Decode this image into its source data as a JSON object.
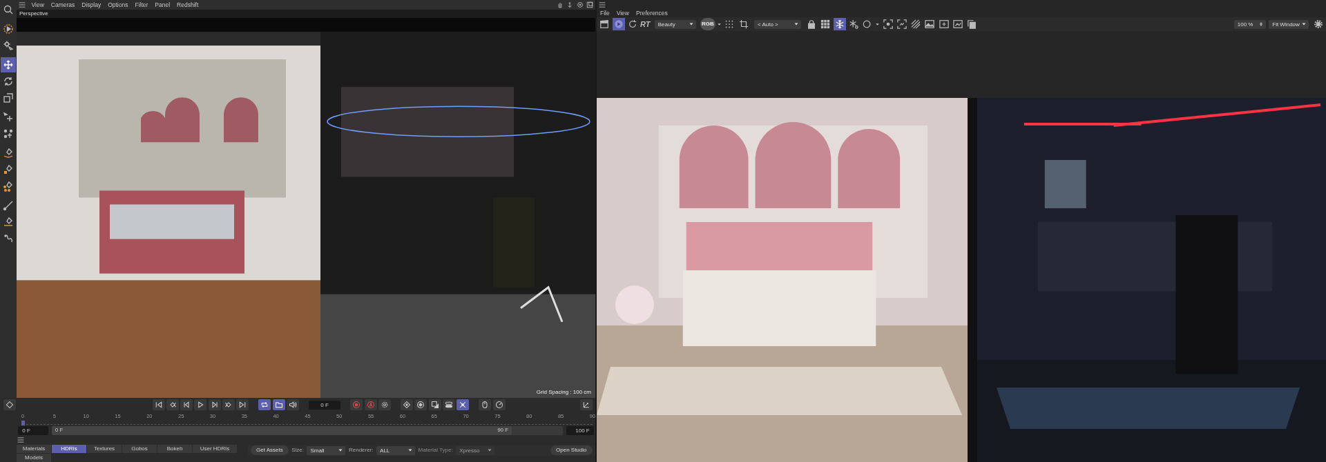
{
  "viewport": {
    "menu": [
      "View",
      "Cameras",
      "Display",
      "Options",
      "Filter",
      "Panel",
      "Redshift"
    ],
    "label": "Perspective",
    "grid_spacing": "Grid Spacing : 100 cm"
  },
  "tools": [
    {
      "selected": false
    },
    {
      "selected": false
    },
    {
      "selected": false
    },
    {
      "selected": true
    },
    {
      "selected": false
    },
    {
      "selected": false
    },
    {
      "selected": false
    },
    {
      "selected": false
    },
    {
      "selected": false
    },
    {
      "selected": false
    },
    {
      "selected": false
    },
    {
      "selected": false
    },
    {
      "selected": false
    },
    {
      "selected": false
    }
  ],
  "timeline": {
    "controls": [
      {
        "kind": "button",
        "selected": false
      },
      {
        "kind": "button",
        "selected": false
      },
      {
        "kind": "button",
        "selected": false
      },
      {
        "kind": "button",
        "selected": false
      },
      {
        "kind": "button",
        "selected": false
      },
      {
        "kind": "button",
        "selected": false
      },
      {
        "kind": "button",
        "selected": false
      },
      {
        "kind": "button",
        "selected": true
      },
      {
        "kind": "button",
        "selected": true
      },
      {
        "kind": "button",
        "selected": false
      },
      {
        "kind": "field",
        "value": "0 F"
      },
      {
        "kind": "button",
        "selected": false
      },
      {
        "kind": "button",
        "selected": false
      },
      {
        "kind": "button",
        "selected": false
      },
      {
        "kind": "button",
        "selected": false
      },
      {
        "kind": "button",
        "selected": false
      },
      {
        "kind": "button",
        "selected": false
      },
      {
        "kind": "button",
        "selected": false
      },
      {
        "kind": "button",
        "selected": true
      },
      {
        "kind": "button",
        "selected": false
      },
      {
        "kind": "button",
        "selected": false
      }
    ],
    "ruler": {
      "level": 0,
      "ticks": [
        "0",
        "5",
        "10",
        "15",
        "20",
        "25",
        "30",
        "35",
        "40",
        "45",
        "50",
        "55",
        "60",
        "65",
        "70",
        "75",
        "80",
        "85",
        "90"
      ]
    },
    "start_field": "0 F",
    "range": {
      "start": "0 F",
      "end": "90 F",
      "level": 0.9
    },
    "end_field": "100 F"
  },
  "asset_tabs": [
    {
      "label": "Materials",
      "selected": false
    },
    {
      "label": "HDRIs",
      "selected": true
    },
    {
      "label": "Textures",
      "selected": false
    },
    {
      "label": "Gobos",
      "selected": false
    },
    {
      "label": "Bokeh",
      "selected": false
    },
    {
      "label": "User HDRIs",
      "selected": false
    },
    {
      "label": "Models",
      "selected": false
    }
  ],
  "asset_bar": {
    "get_assets": "Get Assets",
    "size_label": "Size:",
    "size": "Small",
    "renderer_label": "Renderer:",
    "renderer": "ALL",
    "material_type_label": "Material Type:",
    "material_type": "Xpresso",
    "material_type_disabled": true,
    "open_studio": "Open Studio"
  },
  "render_view": {
    "menu": [
      "File",
      "View",
      "Preferences"
    ],
    "toolbar": [
      {
        "kind": "icon",
        "selected": false
      },
      {
        "kind": "icon",
        "selected": true
      },
      {
        "kind": "icon",
        "selected": false
      },
      {
        "kind": "text",
        "label": "RT"
      },
      {
        "kind": "dropdown",
        "value": "Beauty"
      },
      {
        "kind": "badge",
        "label": "RGB"
      },
      {
        "kind": "icon",
        "selected": false
      },
      {
        "kind": "icon",
        "selected": false
      },
      {
        "kind": "dropdown",
        "value": "< Auto >"
      },
      {
        "kind": "icon",
        "selected": false
      },
      {
        "kind": "icon",
        "selected": false
      },
      {
        "kind": "icon",
        "selected": true
      },
      {
        "kind": "icon",
        "selected": false
      },
      {
        "kind": "icon",
        "selected": false
      },
      {
        "kind": "icon",
        "selected": false
      },
      {
        "kind": "icon",
        "selected": false
      },
      {
        "kind": "icon",
        "selected": false
      },
      {
        "kind": "icon",
        "selected": false
      },
      {
        "kind": "icon",
        "selected": false
      },
      {
        "kind": "icon",
        "selected": false
      },
      {
        "kind": "icon",
        "selected": false
      }
    ],
    "zoom": "100 %",
    "fit": "Fit Window"
  }
}
